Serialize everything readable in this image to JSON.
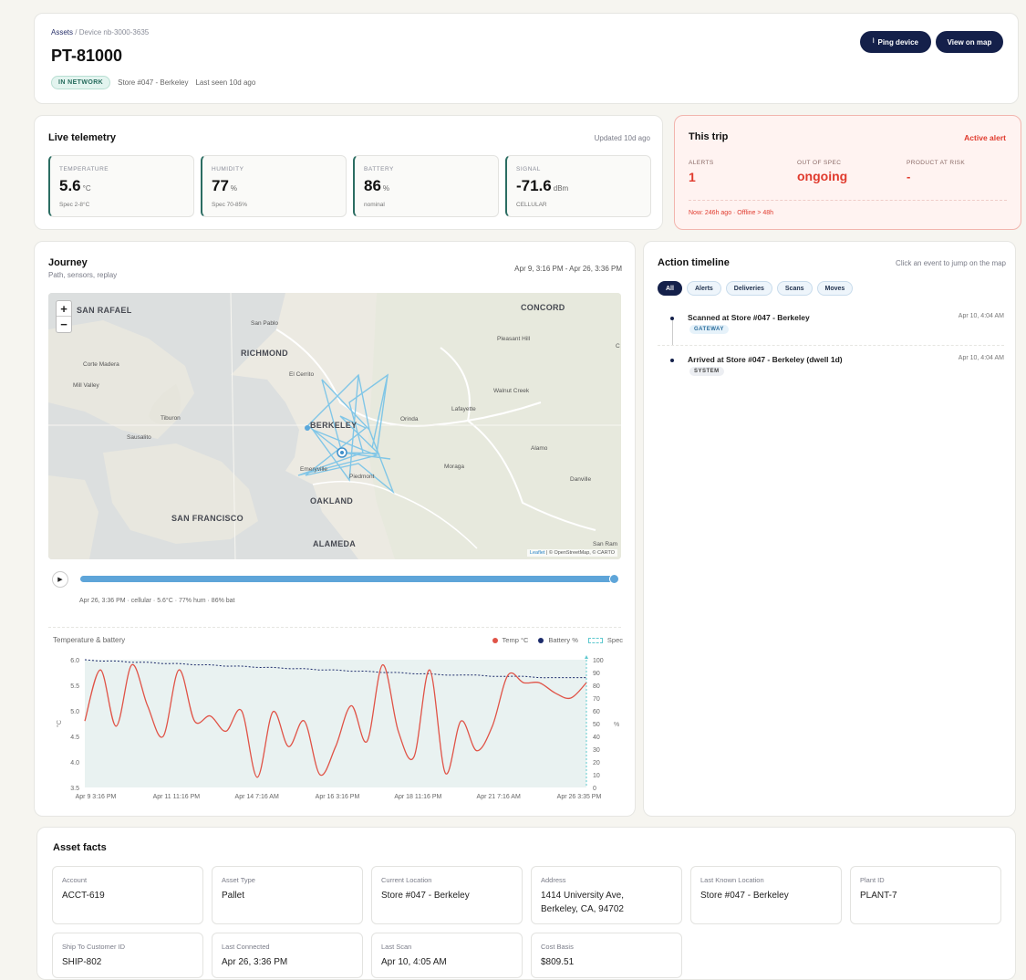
{
  "header": {
    "breadcrumb_root": "Assets",
    "breadcrumb_sep": "/",
    "breadcrumb_current": "Device nb-3000-3635",
    "title": "PT-81000",
    "status_badge": "IN NETWORK",
    "location": "Store #047 - Berkeley",
    "last_seen": "Last seen 10d ago",
    "ping_label": "Ping device",
    "map_label": "View on map"
  },
  "telemetry": {
    "title": "Live telemetry",
    "updated": "Updated 10d ago",
    "metrics": [
      {
        "label": "TEMPERATURE",
        "value": "5.6",
        "unit": "°C",
        "foot": "Spec 2-8°C"
      },
      {
        "label": "HUMIDITY",
        "value": "77",
        "unit": "%",
        "foot": "Spec 70-85%"
      },
      {
        "label": "BATTERY",
        "value": "86",
        "unit": "%",
        "foot": "nominal"
      },
      {
        "label": "SIGNAL",
        "value": "-71.6",
        "unit": "dBm",
        "foot": "CELLULAR"
      }
    ]
  },
  "trip": {
    "title": "This trip",
    "alert": "Active alert",
    "alerts_label": "ALERTS",
    "alerts_value": "1",
    "spec_label": "OUT OF SPEC",
    "spec_value": "ongoing",
    "risk_label": "PRODUCT AT RISK",
    "risk_value": "-",
    "note": "Now: 246h ago · Offline > 48h"
  },
  "journey": {
    "title": "Journey",
    "subtitle": "Path, sensors, replay",
    "range": "Apr 9, 3:16 PM - Apr 26, 3:36 PM",
    "zoom_in": "+",
    "zoom_out": "−",
    "attribution_leaflet": "Leaflet",
    "attribution_rest": "| © OpenStreetMap, © CARTO",
    "replay_status": "Apr 26, 3:36 PM · cellular · 5.6°C · 77% hum · 86% bat",
    "replay_progress": 1.0,
    "map_labels": {
      "san_rafael": "SAN RAFAEL",
      "concord": "CONCORD",
      "san_pablo": "San Pablo",
      "pleasant_hill": "Pleasant Hill",
      "richmond": "RICHMOND",
      "corte_madera": "Corte Madera",
      "el_cerrito": "El Cerrito",
      "mill_valley": "Mill Valley",
      "walnut_creek": "Walnut Creek",
      "lafayette": "Lafayette",
      "tiburon": "Tiburon",
      "berkeley": "BERKELEY",
      "orinda": "Orinda",
      "sausalito": "Sausalito",
      "alamo": "Alamo",
      "emeryville": "Emeryville",
      "piedmont": "Piedmont",
      "moraga": "Moraga",
      "danville": "Danville",
      "oakland": "OAKLAND",
      "san_francisco": "SAN FRANCISCO",
      "alameda": "ALAMEDA",
      "san_ramon": "San Ram",
      "c": "C"
    }
  },
  "timeline": {
    "title": "Action timeline",
    "hint": "Click an event to jump on the map",
    "filters": [
      "All",
      "Alerts",
      "Deliveries",
      "Scans",
      "Moves"
    ],
    "events": [
      {
        "text": "Scanned at Store #047 - Berkeley",
        "tag": "GATEWAY",
        "time": "Apr 10, 4:04 AM"
      },
      {
        "text": "Arrived at Store #047 - Berkeley (dwell 1d)",
        "tag": "SYSTEM",
        "time": "Apr 10, 4:04 AM"
      }
    ]
  },
  "chart_data": {
    "type": "line",
    "title": "Temperature & battery",
    "legend": [
      "Temp °C",
      "Battery %",
      "Spec"
    ],
    "ylabel_left": "°C",
    "ylabel_right": "%",
    "ylim_left": [
      3.5,
      6.0
    ],
    "ylim_right": [
      0,
      100
    ],
    "yticks_left": [
      "6.0",
      "5.5",
      "5.0",
      "4.5",
      "4.0",
      "3.5"
    ],
    "yticks_right": [
      "100",
      "90",
      "80",
      "70",
      "60",
      "50",
      "40",
      "30",
      "20",
      "10",
      "0"
    ],
    "xticks": [
      "Apr 9 3:16 PM",
      "Apr 11 11:16 PM",
      "Apr 14 7:16 AM",
      "Apr 16 3:16 PM",
      "Apr 18 11:16 PM",
      "Apr 21 7:16 AM",
      "Apr 26 3:35 PM"
    ],
    "grid": false,
    "legend_position": "top-right",
    "colors": {
      "temp": "#e05347",
      "battery": "#1c2b6b",
      "spec": "#5fc9cf"
    },
    "series": [
      {
        "name": "Temp °C",
        "values": [
          4.8,
          5.8,
          4.7,
          5.9,
          5.1,
          4.5,
          5.8,
          4.8,
          4.9,
          4.6,
          5.0,
          3.7,
          4.98,
          4.3,
          4.8,
          3.75,
          4.3,
          5.1,
          4.4,
          5.9,
          4.6,
          4.1,
          5.8,
          3.78,
          4.8,
          4.22,
          4.7,
          5.7,
          5.55,
          5.55,
          5.35,
          5.25,
          5.55
        ]
      },
      {
        "name": "Battery %",
        "values": [
          100,
          99,
          99,
          98,
          98,
          97,
          97,
          96,
          96,
          95,
          95,
          94,
          94,
          93,
          93,
          92,
          92,
          91,
          91,
          90,
          90,
          89,
          89,
          88,
          88,
          88,
          87,
          87,
          87,
          86,
          86,
          86,
          86
        ]
      }
    ]
  },
  "facts": {
    "title": "Asset facts",
    "items": [
      {
        "label": "Account",
        "value": "ACCT-619"
      },
      {
        "label": "Asset Type",
        "value": "Pallet"
      },
      {
        "label": "Current Location",
        "value": "Store #047 - Berkeley"
      },
      {
        "label": "Address",
        "value": "1414 University Ave, Berkeley, CA, 94702"
      },
      {
        "label": "Last Known Location",
        "value": "Store #047 - Berkeley"
      },
      {
        "label": "Plant ID",
        "value": "PLANT-7"
      },
      {
        "label": "Ship To Customer ID",
        "value": "SHIP-802"
      },
      {
        "label": "Last Connected",
        "value": "Apr 26, 3:36 PM"
      },
      {
        "label": "Last Scan",
        "value": "Apr 10, 4:05 AM"
      },
      {
        "label": "Cost Basis",
        "value": "$809.51"
      }
    ]
  }
}
